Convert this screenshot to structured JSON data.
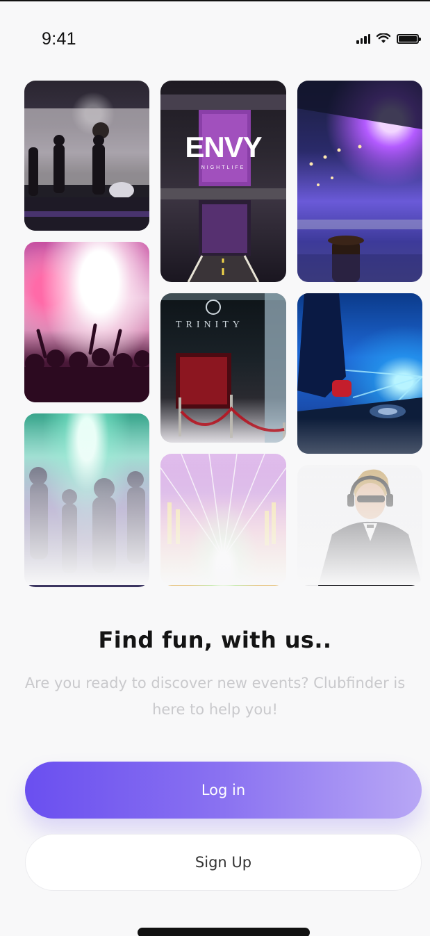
{
  "status_bar": {
    "time": "9:41",
    "icons": [
      "signal-icon",
      "wifi-icon",
      "battery-icon"
    ]
  },
  "gallery": {
    "photos": [
      {
        "name": "photo-live-band",
        "alt": "Live band on stage"
      },
      {
        "name": "photo-envy-nightclub",
        "alt": "Envy nightclub entrance",
        "sign": "ENVY",
        "sign_sub": "NIGHTLIFE"
      },
      {
        "name": "photo-club-interior",
        "alt": "Club interior with purple lights"
      },
      {
        "name": "photo-confetti-crowd",
        "alt": "Crowd with confetti"
      },
      {
        "name": "photo-trinity-entrance",
        "alt": "Trinity club entrance",
        "sign": "TRINITY"
      },
      {
        "name": "photo-dj-decks",
        "alt": "DJ at turntables"
      },
      {
        "name": "photo-dance-crowd",
        "alt": "Dancing crowd under lights"
      },
      {
        "name": "photo-laser-show",
        "alt": "Laser light show"
      },
      {
        "name": "photo-dj-headphones",
        "alt": "DJ with headphones"
      }
    ]
  },
  "content": {
    "headline": "Find fun, with us..",
    "subtitle": "Are you ready to discover new events? Clubfinder is here to help you!"
  },
  "buttons": {
    "login": "Log in",
    "signup": "Sign Up"
  },
  "colors": {
    "primary": "#6a4ff0",
    "primary_light": "#b8a7f5",
    "background": "#f8f8f9",
    "heading": "#141414",
    "subtitle": "#c9c9cc"
  }
}
